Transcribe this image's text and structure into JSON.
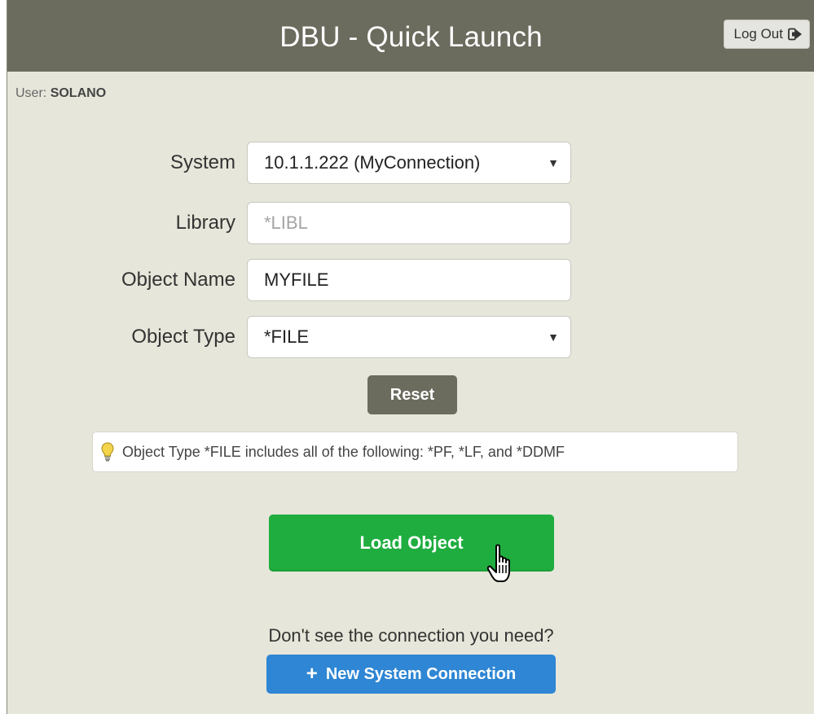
{
  "header": {
    "title": "DBU - Quick Launch",
    "logout_label": "Log Out",
    "logout_icon": "sign-out-icon"
  },
  "user": {
    "label": "User:",
    "name": "SOLANO"
  },
  "form": {
    "system": {
      "label": "System",
      "value": "10.1.1.222 (MyConnection)"
    },
    "library": {
      "label": "Library",
      "placeholder": "*LIBL",
      "value": ""
    },
    "object_name": {
      "label": "Object Name",
      "value": "MYFILE"
    },
    "object_type": {
      "label": "Object Type",
      "value": "*FILE"
    },
    "reset_label": "Reset"
  },
  "hint": {
    "icon": "lightbulb-icon",
    "text": "Object Type *FILE includes all of the following: *PF, *LF, and *DDMF"
  },
  "actions": {
    "load_label": "Load Object",
    "connection_prompt": "Don't see the connection you need?",
    "new_connection_label": "New System Connection"
  },
  "colors": {
    "header_bg": "#6b6b5e",
    "page_bg": "#e6e6da",
    "load_button": "#1fad3f",
    "new_connection_button": "#2e86d4",
    "reset_button": "#6b6b5e"
  }
}
